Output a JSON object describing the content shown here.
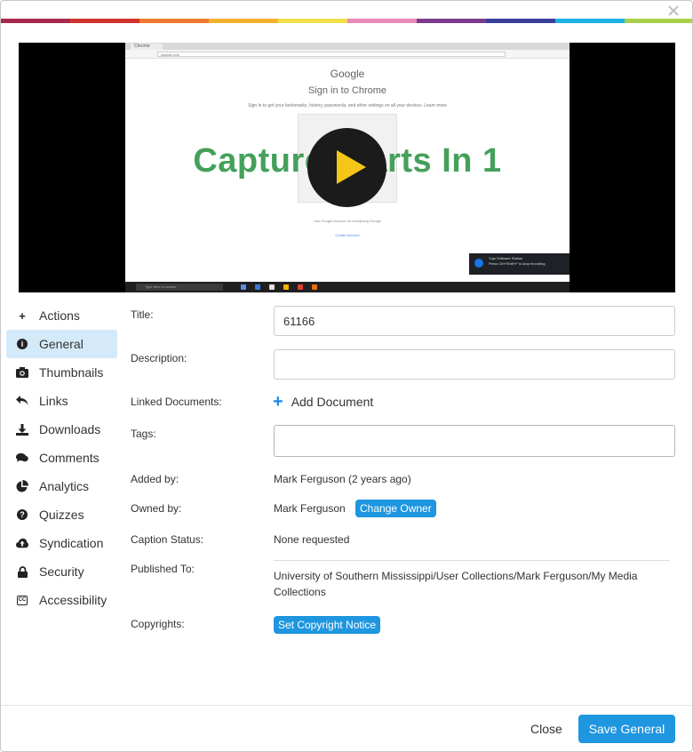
{
  "theme": {
    "accent": "#1e96e0",
    "active_bg": "#d4eaf9",
    "rainbow": [
      "#a8294d",
      "#d1342f",
      "#ef7a2f",
      "#f2b230",
      "#f2e04a",
      "#e98bb8",
      "#7c3b8e",
      "#3a3f9a",
      "#1ab3e3",
      "#a7cf4a"
    ]
  },
  "video": {
    "overlay_text": "Capture Starts In 1",
    "browser_tab": "Chrome",
    "address": "wayfair.com",
    "google_logo": "Google",
    "sign_in_title": "Sign in to Chrome",
    "sign_in_sub": "Sign in to get your bookmarks, history, passwords, and other settings on all your devices. Learn more",
    "card_footer": "Use Google Account for everything Google",
    "create_account": "Create account",
    "toast_title": "Yuja Software Station",
    "toast_text": "Press Ctrl+Shift+F to stop recording",
    "taskbar_search": "Type here to search",
    "play_icon": "play-icon"
  },
  "sidebar": {
    "items": [
      {
        "label": "Actions",
        "icon": "plus-icon"
      },
      {
        "label": "General",
        "icon": "info-icon"
      },
      {
        "label": "Thumbnails",
        "icon": "camera-icon"
      },
      {
        "label": "Links",
        "icon": "reply-arrow-icon"
      },
      {
        "label": "Downloads",
        "icon": "download-icon"
      },
      {
        "label": "Comments",
        "icon": "comments-icon"
      },
      {
        "label": "Analytics",
        "icon": "pie-chart-icon"
      },
      {
        "label": "Quizzes",
        "icon": "question-icon"
      },
      {
        "label": "Syndication",
        "icon": "cloud-upload-icon"
      },
      {
        "label": "Security",
        "icon": "lock-icon"
      },
      {
        "label": "Accessibility",
        "icon": "closed-captions-icon"
      }
    ],
    "active": "General"
  },
  "form": {
    "title_label": "Title:",
    "title_value": "61166",
    "description_label": "Description:",
    "description_value": "",
    "linked_docs_label": "Linked Documents:",
    "add_document": "Add Document",
    "tags_label": "Tags:",
    "tags_value": "",
    "added_by_label": "Added by:",
    "added_by_value": "Mark Ferguson (2 years ago)",
    "owned_by_label": "Owned by:",
    "owned_by_value": "Mark Ferguson",
    "change_owner": "Change Owner",
    "caption_status_label": "Caption Status:",
    "caption_status_value": "None requested",
    "published_to_label": "Published To:",
    "published_to_value": "University of Southern Mississippi/User Collections/Mark Ferguson/My Media Collections",
    "copyrights_label": "Copyrights:",
    "set_copyright": "Set Copyright Notice"
  },
  "footer": {
    "close": "Close",
    "save": "Save General"
  }
}
